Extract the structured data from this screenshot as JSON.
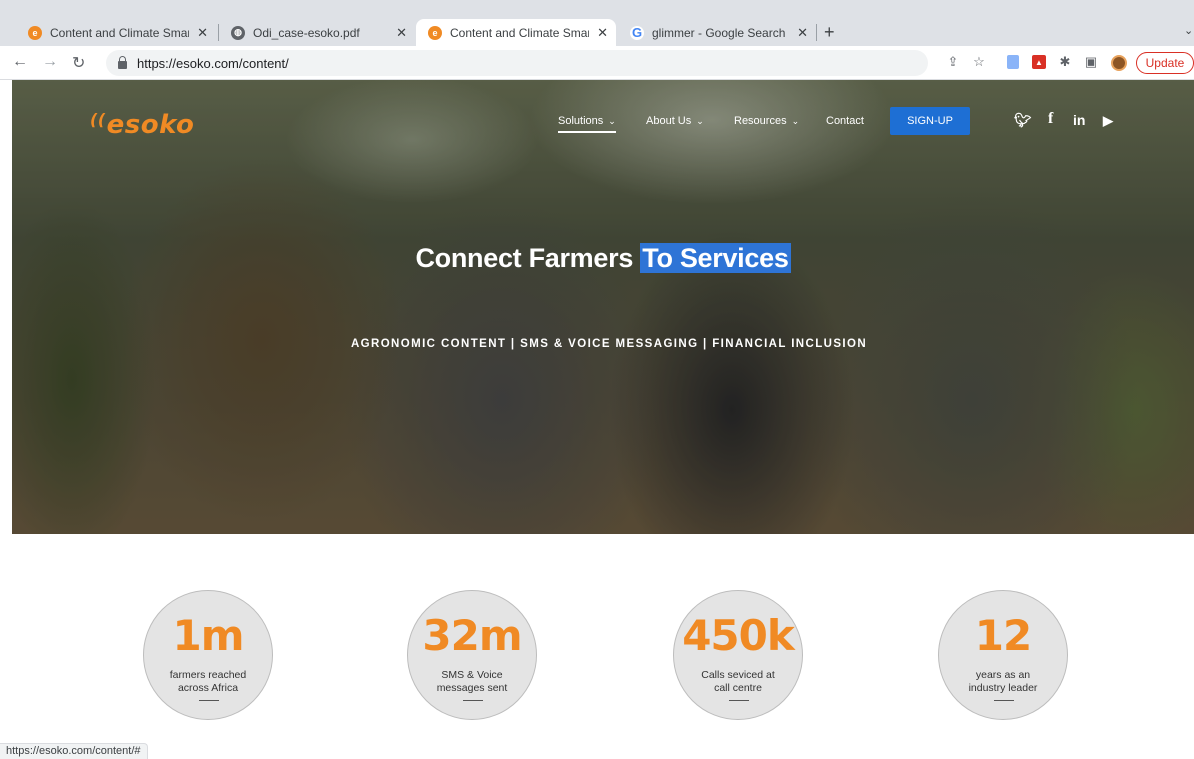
{
  "tabs": [
    {
      "title": "Content and Climate Smart Agr",
      "favicon": "esoko-favicon"
    },
    {
      "title": "Odi_case-esoko.pdf",
      "favicon": "globe-icon"
    },
    {
      "title": "Content and Climate Smart Agr",
      "favicon": "esoko-favicon",
      "active": true
    },
    {
      "title": "glimmer - Google Search",
      "favicon": "google-icon"
    }
  ],
  "toolbar": {
    "url": "https://esoko.com/content/",
    "update_label": "Update"
  },
  "site": {
    "logo": "esoko",
    "nav": [
      {
        "label": "Solutions",
        "chevron": "⌄"
      },
      {
        "label": "About Us",
        "chevron": "⌄"
      },
      {
        "label": "Resources",
        "chevron": "⌄"
      },
      {
        "label": "Contact"
      }
    ],
    "signup_label": "SIGN-UP",
    "social_icons": [
      "twitter-icon",
      "facebook-icon",
      "linkedin-icon",
      "youtube-icon"
    ]
  },
  "hero": {
    "title_plain": "Connect Farmers ",
    "title_highlight": "To Services",
    "subtitle": "AGRONOMIC CONTENT | SMS & VOICE MESSAGING | FINANCIAL INCLUSION"
  },
  "stats": [
    {
      "value": "1m",
      "line1": "farmers reached",
      "line2": "across Africa"
    },
    {
      "value": "32m",
      "line1": "SMS & Voice",
      "line2": "messages sent"
    },
    {
      "value": "450k",
      "line1": "Calls seviced at",
      "line2": "call centre"
    },
    {
      "value": "12",
      "line1": "years as an",
      "line2": "industry leader"
    }
  ],
  "status_url": "https://esoko.com/content/#",
  "colors": {
    "accent": "#f08a24",
    "signup": "#1e6fd4",
    "highlight": "#2e74d6"
  }
}
